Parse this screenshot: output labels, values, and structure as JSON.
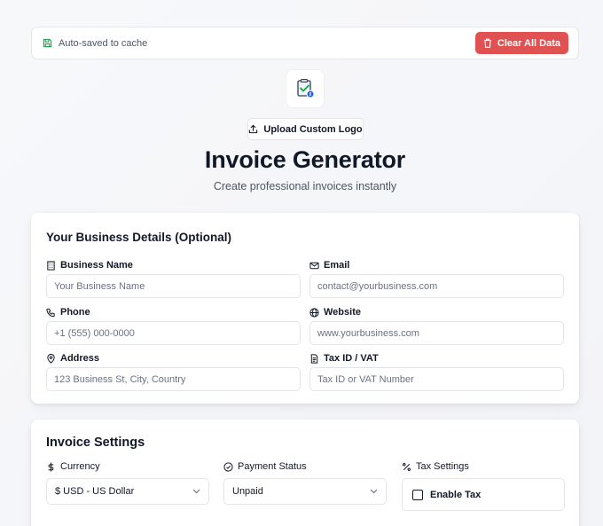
{
  "topbar": {
    "autosave_text": "Auto-saved to cache",
    "clear_label": "Clear All Data"
  },
  "logo": {
    "icon": "invoice-check-icon"
  },
  "upload_label": "Upload Custom Logo",
  "title": "Invoice Generator",
  "subtitle": "Create professional invoices instantly",
  "business": {
    "title": "Your Business Details (Optional)",
    "fields": [
      {
        "label": "Business Name",
        "placeholder": "Your Business Name",
        "icon": "building-icon"
      },
      {
        "label": "Email",
        "placeholder": "contact@yourbusiness.com",
        "icon": "mail-icon"
      },
      {
        "label": "Phone",
        "placeholder": "+1 (555) 000-0000",
        "icon": "phone-icon"
      },
      {
        "label": "Website",
        "placeholder": "www.yourbusiness.com",
        "icon": "globe-icon"
      },
      {
        "label": "Address",
        "placeholder": "123 Business St, City, Country",
        "icon": "map-pin-icon"
      },
      {
        "label": "Tax ID / VAT",
        "placeholder": "Tax ID or VAT Number",
        "icon": "document-icon"
      }
    ]
  },
  "settings": {
    "title": "Invoice Settings",
    "currency_label": "Currency",
    "currency_value": "$ USD - US Dollar",
    "status_label": "Payment Status",
    "status_value": "Unpaid",
    "tax_label": "Tax Settings",
    "tax_checkbox_label": "Enable Tax",
    "tax_enabled": false
  },
  "colors": {
    "danger": "#e05252",
    "text": "#111827",
    "muted": "#4b5563",
    "autosave_icon": "#16a34a"
  }
}
